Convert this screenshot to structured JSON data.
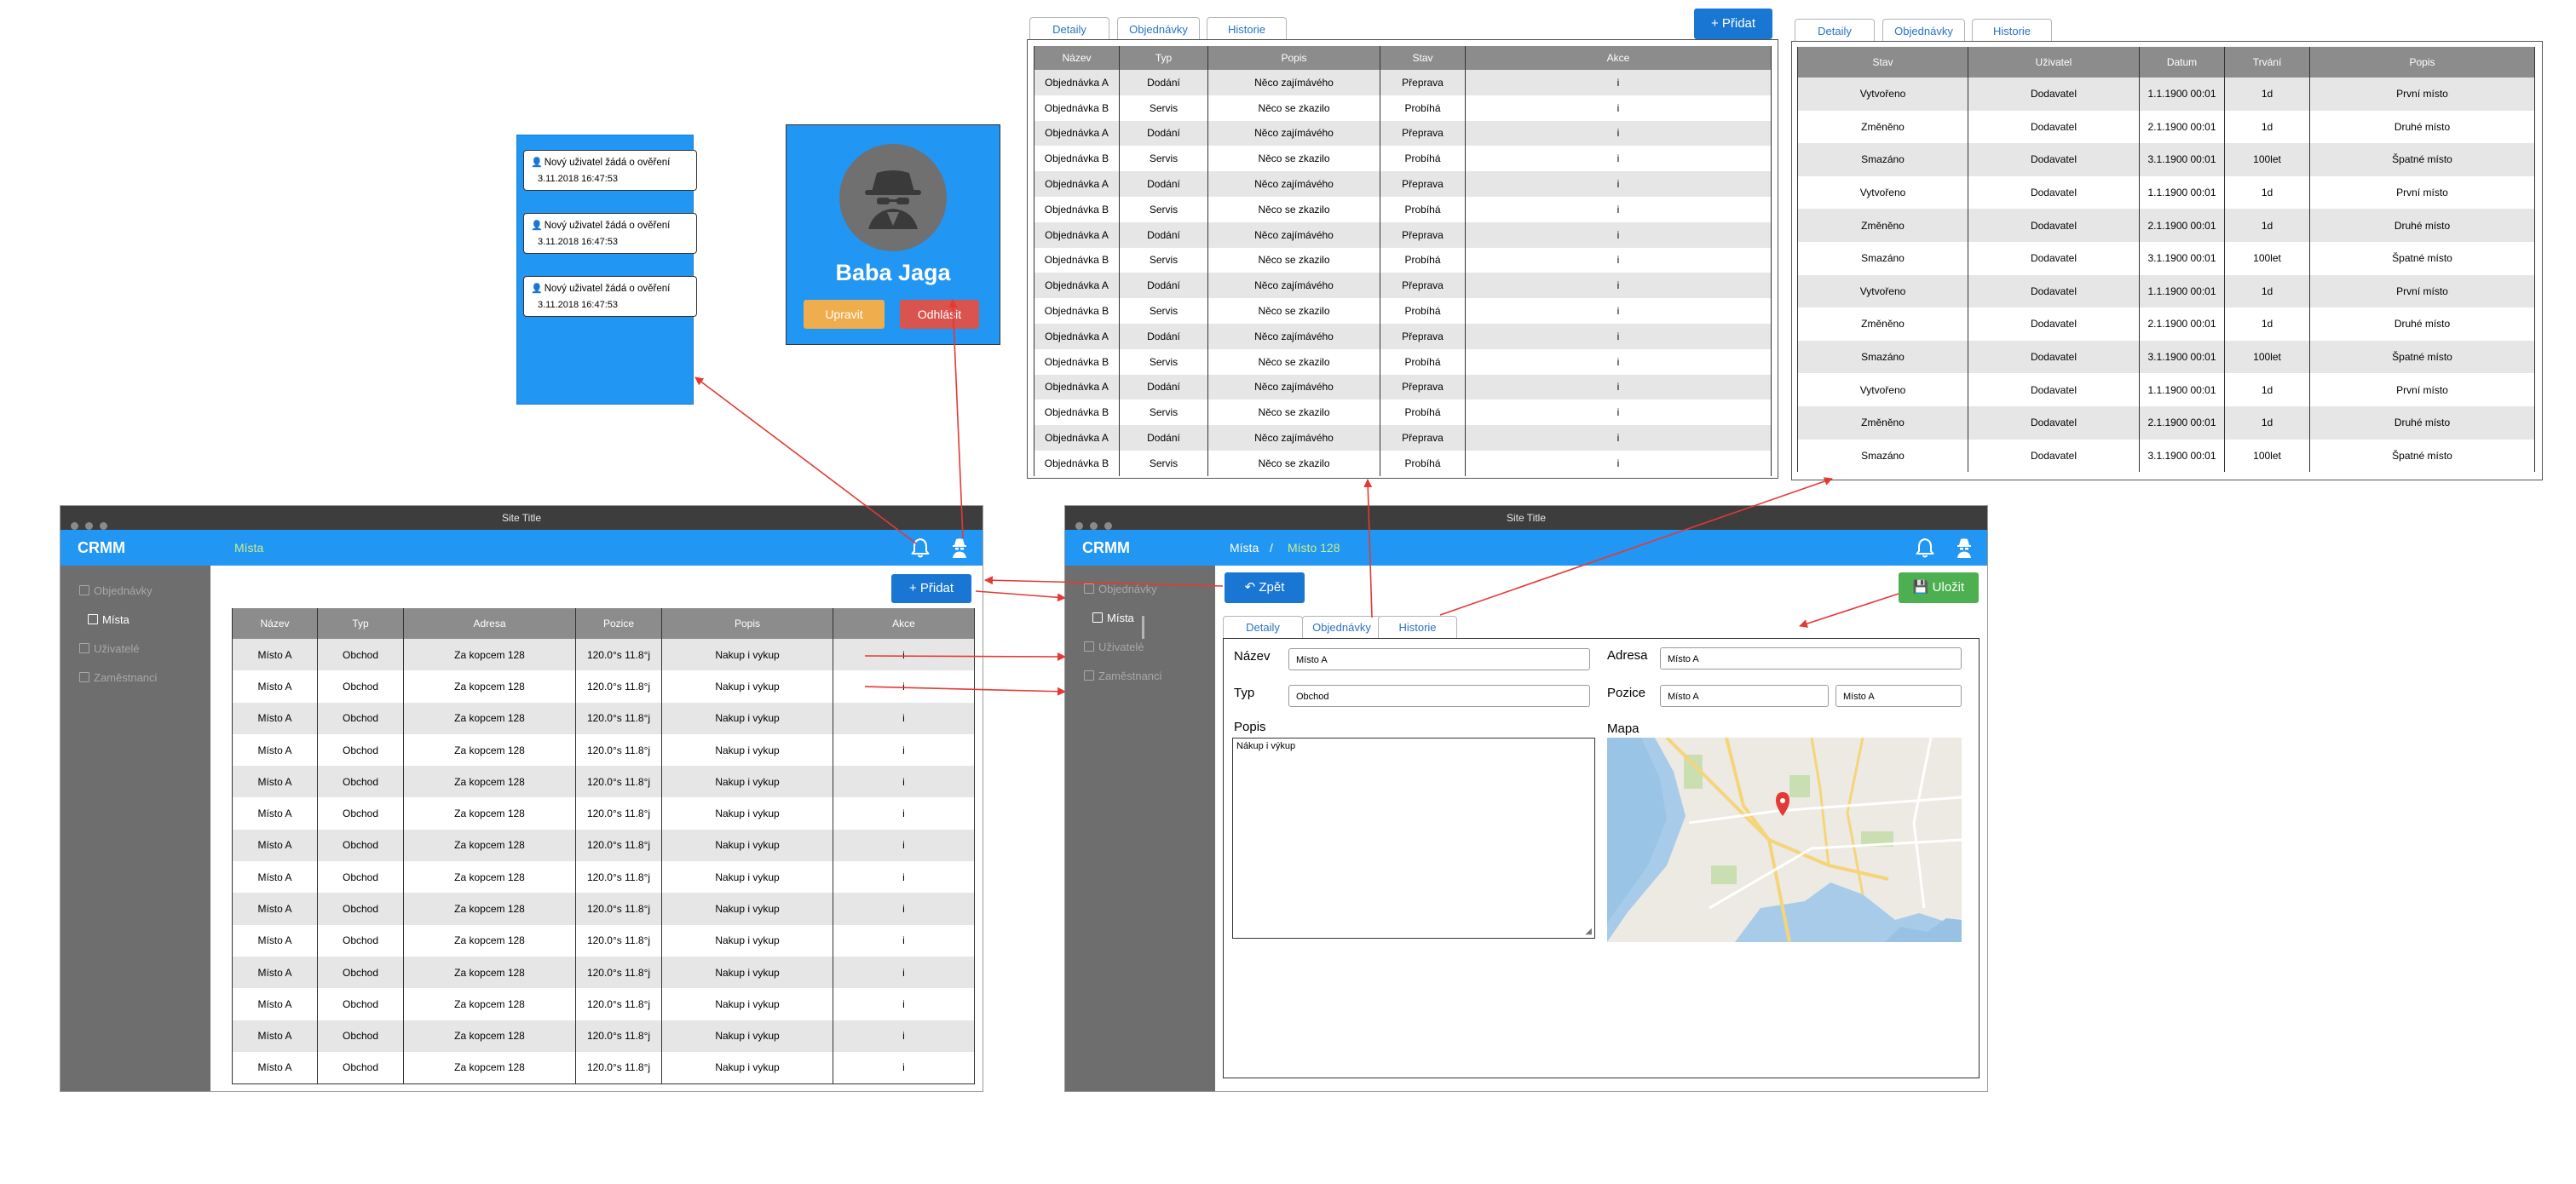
{
  "notifications": [
    {
      "text": "Nový uživatel žádá o ověření",
      "date": "3.11.2018 16:47:53"
    },
    {
      "text": "Nový uživatel žádá o ověření",
      "date": "3.11.2018 16:47:53"
    },
    {
      "text": "Nový uživatel žádá o ověření",
      "date": "3.11.2018 16:47:53"
    }
  ],
  "profile": {
    "name": "Baba Jaga",
    "edit": "Upravit",
    "logout": "Odhlásit"
  },
  "orders_panel": {
    "tabs": [
      "Detaily",
      "Objednávky",
      "Historie"
    ],
    "add": "+ Přidat",
    "columns": [
      "Název",
      "Typ",
      "Popis",
      "Stav",
      "Akce"
    ],
    "rows": [
      [
        "Objednávka A",
        "Dodání",
        "Něco zajímávého",
        "Přeprava",
        "i"
      ],
      [
        "Objednávka B",
        "Servis",
        "Něco se zkazilo",
        "Probíhá",
        "i"
      ],
      [
        "Objednávka A",
        "Dodání",
        "Něco zajímávého",
        "Přeprava",
        "i"
      ],
      [
        "Objednávka B",
        "Servis",
        "Něco se zkazilo",
        "Probíhá",
        "i"
      ],
      [
        "Objednávka A",
        "Dodání",
        "Něco zajímávého",
        "Přeprava",
        "i"
      ],
      [
        "Objednávka B",
        "Servis",
        "Něco se zkazilo",
        "Probíhá",
        "i"
      ],
      [
        "Objednávka A",
        "Dodání",
        "Něco zajímávého",
        "Přeprava",
        "i"
      ],
      [
        "Objednávka B",
        "Servis",
        "Něco se zkazilo",
        "Probíhá",
        "i"
      ],
      [
        "Objednávka A",
        "Dodání",
        "Něco zajímávého",
        "Přeprava",
        "i"
      ],
      [
        "Objednávka B",
        "Servis",
        "Něco se zkazilo",
        "Probíhá",
        "i"
      ],
      [
        "Objednávka A",
        "Dodání",
        "Něco zajímávého",
        "Přeprava",
        "i"
      ],
      [
        "Objednávka B",
        "Servis",
        "Něco se zkazilo",
        "Probíhá",
        "i"
      ],
      [
        "Objednávka A",
        "Dodání",
        "Něco zajímávého",
        "Přeprava",
        "i"
      ],
      [
        "Objednávka B",
        "Servis",
        "Něco se zkazilo",
        "Probíhá",
        "i"
      ],
      [
        "Objednávka A",
        "Dodání",
        "Něco zajímávého",
        "Přeprava",
        "i"
      ],
      [
        "Objednávka B",
        "Servis",
        "Něco se zkazilo",
        "Probíhá",
        "i"
      ]
    ]
  },
  "history_panel": {
    "tabs": [
      "Detaily",
      "Objednávky",
      "Historie"
    ],
    "columns": [
      "Stav",
      "Uživatel",
      "Datum",
      "Trvání",
      "Popis"
    ],
    "rows": [
      [
        "Vytvořeno",
        "Dodavatel",
        "1.1.1900 00:01",
        "1d",
        "První místo"
      ],
      [
        "Změněno",
        "Dodavatel",
        "2.1.1900 00:01",
        "1d",
        "Druhé místo"
      ],
      [
        "Smazáno",
        "Dodavatel",
        "3.1.1900 00:01",
        "100let",
        "Špatné místo"
      ],
      [
        "Vytvořeno",
        "Dodavatel",
        "1.1.1900 00:01",
        "1d",
        "První místo"
      ],
      [
        "Změněno",
        "Dodavatel",
        "2.1.1900 00:01",
        "1d",
        "Druhé místo"
      ],
      [
        "Smazáno",
        "Dodavatel",
        "3.1.1900 00:01",
        "100let",
        "Špatné místo"
      ],
      [
        "Vytvořeno",
        "Dodavatel",
        "1.1.1900 00:01",
        "1d",
        "První místo"
      ],
      [
        "Změněno",
        "Dodavatel",
        "2.1.1900 00:01",
        "1d",
        "Druhé místo"
      ],
      [
        "Smazáno",
        "Dodavatel",
        "3.1.1900 00:01",
        "100let",
        "Špatné místo"
      ],
      [
        "Vytvořeno",
        "Dodavatel",
        "1.1.1900 00:01",
        "1d",
        "První místo"
      ],
      [
        "Změněno",
        "Dodavatel",
        "2.1.1900 00:01",
        "1d",
        "Druhé místo"
      ],
      [
        "Smazáno",
        "Dodavatel",
        "3.1.1900 00:01",
        "100let",
        "Špatné místo"
      ]
    ]
  },
  "app": {
    "site_title": "Site Title",
    "brand": "CRMM",
    "nav": [
      "Objednávky",
      "Místa",
      "Uživatelé",
      "Zaměstnanci"
    ]
  },
  "list_window": {
    "breadcrumb": "Místa",
    "add": "+ Přidat",
    "columns": [
      "Název",
      "Typ",
      "Adresa",
      "Pozice",
      "Popis",
      "Akce"
    ],
    "rows": [
      [
        "Místo A",
        "Obchod",
        "Za kopcem 128",
        "120.0°s 11.8°j",
        "Nakup i vykup",
        "i"
      ],
      [
        "Místo A",
        "Obchod",
        "Za kopcem 128",
        "120.0°s 11.8°j",
        "Nakup i vykup",
        "i"
      ],
      [
        "Místo A",
        "Obchod",
        "Za kopcem 128",
        "120.0°s 11.8°j",
        "Nakup i vykup",
        "i"
      ],
      [
        "Místo A",
        "Obchod",
        "Za kopcem 128",
        "120.0°s 11.8°j",
        "Nakup i vykup",
        "i"
      ],
      [
        "Místo A",
        "Obchod",
        "Za kopcem 128",
        "120.0°s 11.8°j",
        "Nakup i vykup",
        "i"
      ],
      [
        "Místo A",
        "Obchod",
        "Za kopcem 128",
        "120.0°s 11.8°j",
        "Nakup i vykup",
        "i"
      ],
      [
        "Místo A",
        "Obchod",
        "Za kopcem 128",
        "120.0°s 11.8°j",
        "Nakup i vykup",
        "i"
      ],
      [
        "Místo A",
        "Obchod",
        "Za kopcem 128",
        "120.0°s 11.8°j",
        "Nakup i vykup",
        "i"
      ],
      [
        "Místo A",
        "Obchod",
        "Za kopcem 128",
        "120.0°s 11.8°j",
        "Nakup i vykup",
        "i"
      ],
      [
        "Místo A",
        "Obchod",
        "Za kopcem 128",
        "120.0°s 11.8°j",
        "Nakup i vykup",
        "i"
      ],
      [
        "Místo A",
        "Obchod",
        "Za kopcem 128",
        "120.0°s 11.8°j",
        "Nakup i vykup",
        "i"
      ],
      [
        "Místo A",
        "Obchod",
        "Za kopcem 128",
        "120.0°s 11.8°j",
        "Nakup i vykup",
        "i"
      ],
      [
        "Místo A",
        "Obchod",
        "Za kopcem 128",
        "120.0°s 11.8°j",
        "Nakup i vykup",
        "i"
      ],
      [
        "Místo A",
        "Obchod",
        "Za kopcem 128",
        "120.0°s 11.8°j",
        "Nakup i vykup",
        "i"
      ]
    ]
  },
  "detail_window": {
    "breadcrumb_parent": "Místa",
    "breadcrumb_sep": "/",
    "breadcrumb_current": "Místo 128",
    "back": "↶ Zpět",
    "save": "💾 Uložit",
    "tabs": [
      "Detaily",
      "Objednávky",
      "Historie"
    ],
    "labels": {
      "name": "Název",
      "address": "Adresa",
      "type": "Typ",
      "position": "Pozice",
      "description": "Popis",
      "map": "Mapa"
    },
    "values": {
      "name": "Místo A",
      "address": "Místo A",
      "type": "Obchod",
      "position_a": "Místo A",
      "position_b": "Místo A",
      "description": "Nákup i výkup"
    }
  },
  "colors": {
    "primary": "#2196f3",
    "sidebar": "#6e6e6e",
    "titlebar": "#3d3d3d",
    "success": "#4caf50",
    "warning": "#f0ad4e",
    "danger": "#d9534f",
    "arrow": "#e53935"
  }
}
